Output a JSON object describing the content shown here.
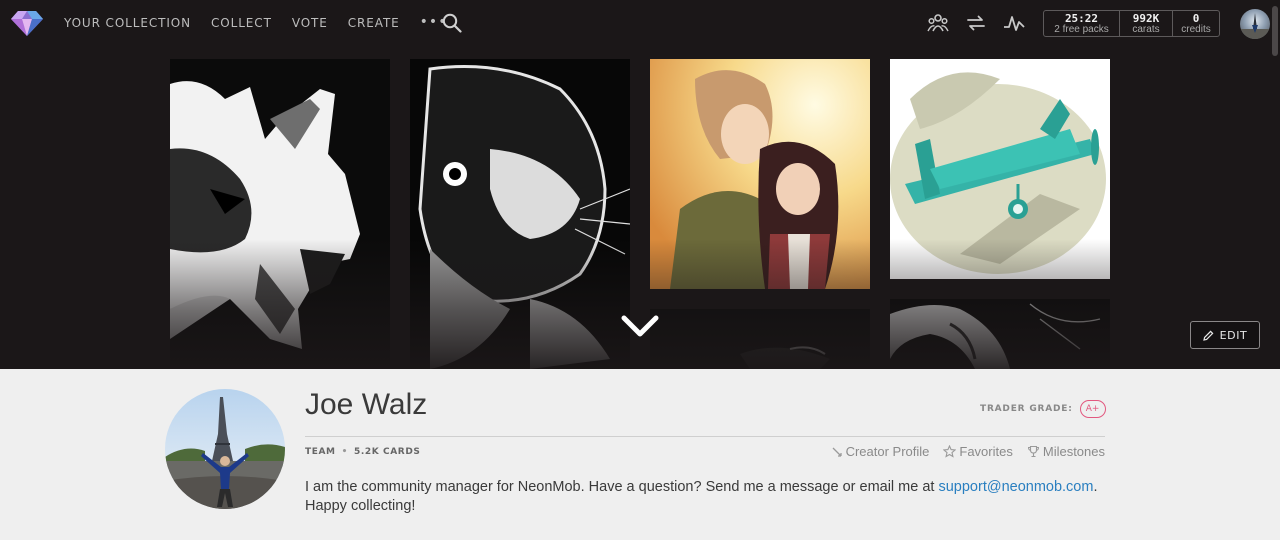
{
  "nav": {
    "links": [
      "YOUR COLLECTION",
      "COLLECT",
      "VOTE",
      "CREATE"
    ],
    "more": "•••",
    "stats": [
      {
        "value": "25:22",
        "label": "2 free packs"
      },
      {
        "value": "992K",
        "label": "carats"
      },
      {
        "value": "0",
        "label": "credits"
      }
    ]
  },
  "banner": {
    "edit_label": "EDIT"
  },
  "profile": {
    "name": "Joe Walz",
    "trader_grade_label": "TRADER GRADE:",
    "trader_grade": "A+",
    "team_label": "TEAM",
    "cards_count": "5.2K CARDS",
    "links": {
      "creator": "Creator Profile",
      "favorites": "Favorites",
      "milestones": "Milestones"
    },
    "bio_text": "I am the community manager for NeonMob. Have a question? Send me a message or email me at",
    "bio_email": "support@neonmob.com",
    "bio_suffix": ". Happy collecting!"
  },
  "colors": {
    "nav_bg": "#1b1718",
    "grade_accent": "#e2587f",
    "link_blue": "#2a7fc0",
    "airplane_teal": "#35b3a8"
  },
  "icons": [
    "neonmob-logo-icon",
    "search-icon",
    "community-icon",
    "trade-icon",
    "activity-icon",
    "chevron-down-icon",
    "pencil-icon",
    "creator-icon",
    "star-icon",
    "trophy-icon"
  ]
}
